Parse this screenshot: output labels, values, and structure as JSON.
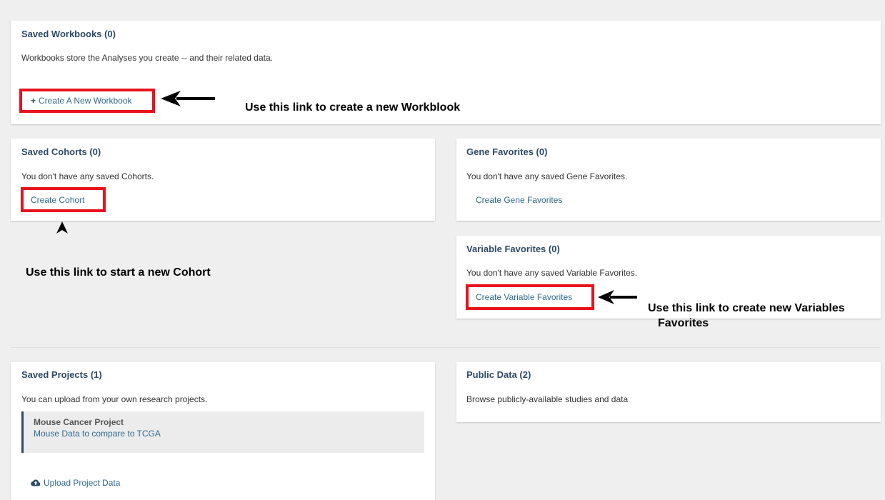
{
  "workbooks": {
    "title": "Saved Workbooks (0)",
    "description": "Workbooks store the Analyses you create -- and their related data.",
    "create_link": "Create A New Workbook"
  },
  "cohorts": {
    "title": "Saved Cohorts (0)",
    "empty_text": "You don't have any saved Cohorts.",
    "create_link": "Create Cohort"
  },
  "gene_favorites": {
    "title": "Gene Favorites (0)",
    "empty_text": "You don't have any saved Gene Favorites.",
    "create_link": "Create Gene Favorites"
  },
  "variable_favorites": {
    "title": "Variable Favorites (0)",
    "empty_text": "You don't have any saved Variable Favorites.",
    "create_link": "Create Variable Favorites"
  },
  "projects": {
    "title": "Saved Projects (1)",
    "description": "You can upload from your own research projects.",
    "items": [
      {
        "name": "Mouse Cancer Project",
        "subtitle": "Mouse Data to compare to TCGA"
      }
    ],
    "upload_link": "Upload Project Data"
  },
  "public_data": {
    "title": "Public Data (2)",
    "description": "Browse publicly-available studies and data"
  },
  "annotations": {
    "workbook_note": "Use this link to create a new Workblook",
    "cohort_note": "Use this link to start a new Cohort",
    "variable_note_line1": "Use this link to create new Variables",
    "variable_note_line2": "Favorites"
  },
  "colors": {
    "accent_link": "#2f6a92",
    "title": "#2e4a66",
    "highlight_red": "#e8121c"
  }
}
